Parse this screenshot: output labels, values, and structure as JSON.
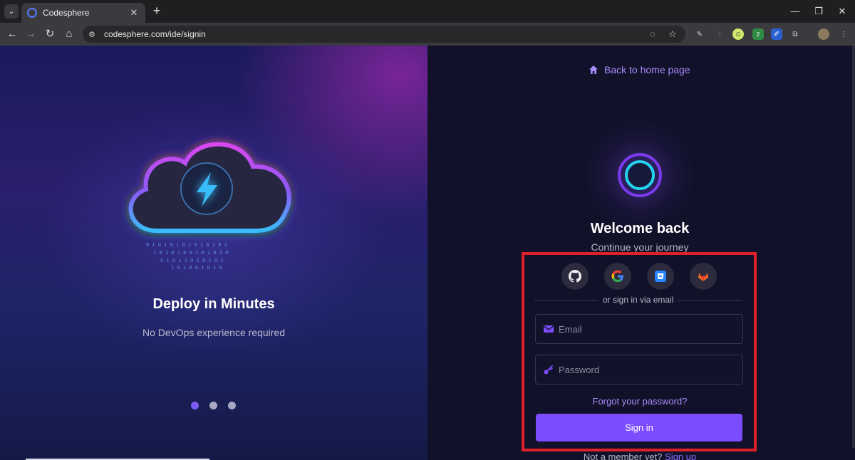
{
  "browser": {
    "tab_title": "Codesphere",
    "url": "codesphere.com/ide/signin",
    "extension_badge": "2"
  },
  "left_panel": {
    "slide_title": "Deploy in Minutes",
    "slide_subtitle": "No DevOps experience required",
    "dots_count": 3,
    "active_dot": 0,
    "binary_rows": [
      "0 1 0 1 0 1 0 1 0 1 0 1 0 1",
      "1 0 1 0 1 0 0 1 0 1 0 1 0",
      "0 1 0 1 1 0 1 0 1 0 1",
      "1 0 1 0 0 1 0 1 0",
      "0 1 0 1 0 1 0"
    ]
  },
  "right_panel": {
    "back_link": "Back to home page",
    "welcome": "Welcome back",
    "subtitle": "Continue your journey",
    "divider_text": "or sign in via email",
    "email_placeholder": "Email",
    "password_placeholder": "Password",
    "forgot": "Forgot your password?",
    "signin_button": "Sign in",
    "member_text": "Not a member yet?",
    "signup_link": "Sign up"
  },
  "colors": {
    "accent": "#7c4dff",
    "link": "#a78bfa",
    "highlight": "#e2202a"
  },
  "icons": [
    "github-icon",
    "google-icon",
    "bitbucket-icon",
    "gitlab-icon",
    "email-icon",
    "key-icon",
    "home-icon",
    "lightning-icon"
  ]
}
